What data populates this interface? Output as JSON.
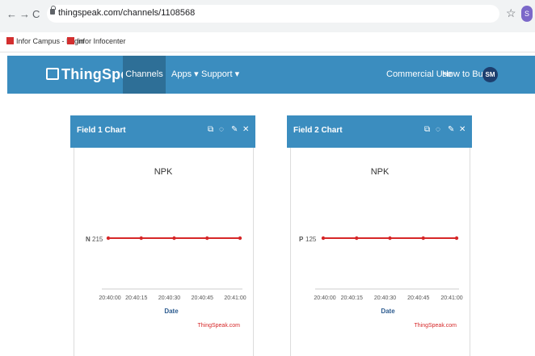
{
  "browser": {
    "url": "thingspeak.com/channels/1108568",
    "profile_initial": "S",
    "bookmarks": [
      {
        "label": "Infor Campus - Login"
      },
      {
        "label": "Infor Infocenter"
      }
    ]
  },
  "nav": {
    "logo": "ThingSpeak",
    "logo_tm": "™",
    "channels": "Channels ▾",
    "apps": "Apps ▾",
    "support": "Support ▾",
    "commercial": "Commercial Use",
    "howtobuy": "How to Buy",
    "avatar": "SM"
  },
  "panels": [
    {
      "title": "Field 1 Chart"
    },
    {
      "title": "Field 2 Chart"
    }
  ],
  "chart_data": [
    {
      "type": "line",
      "title": "NPK",
      "xlabel": "Date",
      "ylabel": "N",
      "x": [
        "20:40:00",
        "20:40:15",
        "20:40:30",
        "20:40:45",
        "20:41:00"
      ],
      "series": [
        {
          "values": [
            215,
            215,
            215,
            215,
            215
          ]
        }
      ],
      "y_tick_label": "215",
      "credit": "ThingSpeak.com",
      "line_color": "#d62728"
    },
    {
      "type": "line",
      "title": "NPK",
      "xlabel": "Date",
      "ylabel": "P",
      "x": [
        "20:40:00",
        "20:40:15",
        "20:40:30",
        "20:40:45",
        "20:41:00"
      ],
      "series": [
        {
          "values": [
            125,
            125,
            125,
            125,
            125
          ]
        }
      ],
      "y_tick_label": "125",
      "credit": "ThingSpeak.com",
      "line_color": "#d62728"
    }
  ]
}
